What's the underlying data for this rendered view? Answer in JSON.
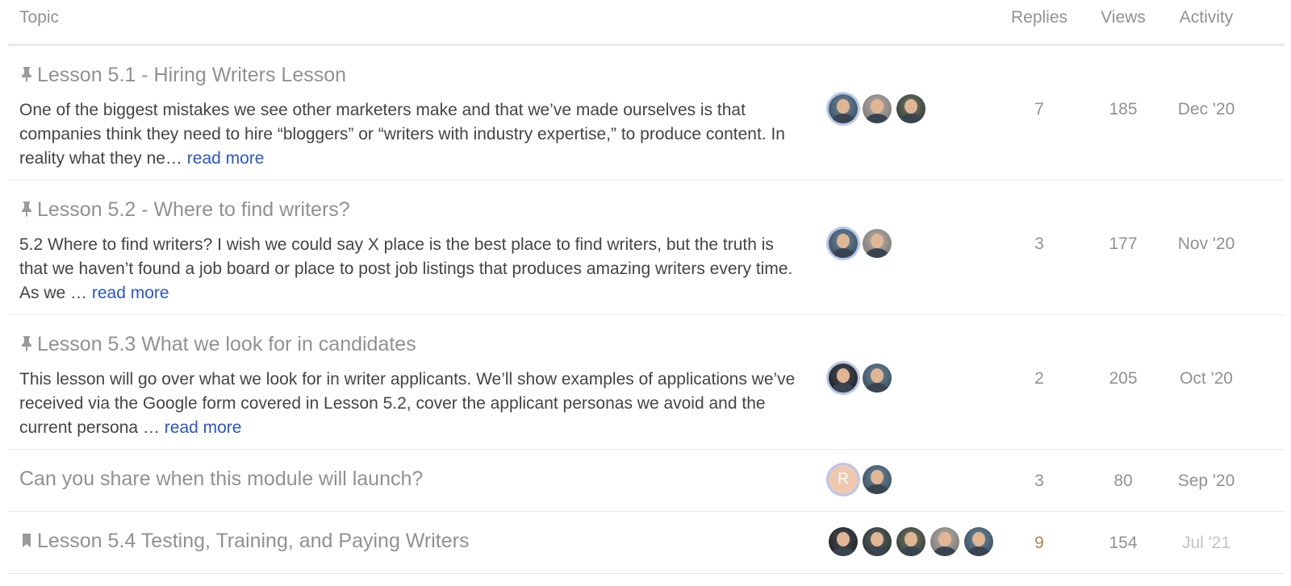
{
  "header": {
    "topic": "Topic",
    "replies": "Replies",
    "views": "Views",
    "activity": "Activity"
  },
  "topics": [
    {
      "title": "Lesson 5.1 - Hiring Writers Lesson",
      "icon": "pin-icon",
      "excerpt": "One of the biggest mistakes we see other marketers make and that we’ve made ourselves is that companies think they need to hire “bloggers” or “writers with industry expertise,” to produce content. In reality what they ne…",
      "read_more": "read more",
      "replies": "7",
      "views": "185",
      "activity": "Dec '20"
    },
    {
      "title": "Lesson 5.2 - Where to find writers?",
      "icon": "pin-icon",
      "excerpt": "5.2 Where to find writers? I wish we could say X place is the best place to find writers, but the truth is that we haven’t found a job board or place to post job listings that produces amazing writers every time. As we …",
      "read_more": "read more",
      "replies": "3",
      "views": "177",
      "activity": "Nov '20"
    },
    {
      "title": "Lesson 5.3 What we look for in candidates",
      "icon": "pin-icon",
      "excerpt": "This lesson will go over what we look for in writer applicants. We’ll show examples of applications we’ve received via the Google form covered in Lesson 5.2, cover the applicant personas we avoid and the current persona …",
      "read_more": "read more",
      "replies": "2",
      "views": "205",
      "activity": "Oct '20"
    },
    {
      "title": "Can you share when this module will launch?",
      "avatar_letter": "R",
      "replies": "3",
      "views": "80",
      "activity": "Sep '20"
    },
    {
      "title": "Lesson 5.4 Testing, Training, and Paying Writers",
      "icon": "bookmark-icon",
      "replies": "9",
      "views": "154",
      "activity": "Jul '21"
    }
  ],
  "colors": {
    "link": "#2a55d3",
    "muted": "#919191",
    "hot_replies": "#a8864a"
  }
}
